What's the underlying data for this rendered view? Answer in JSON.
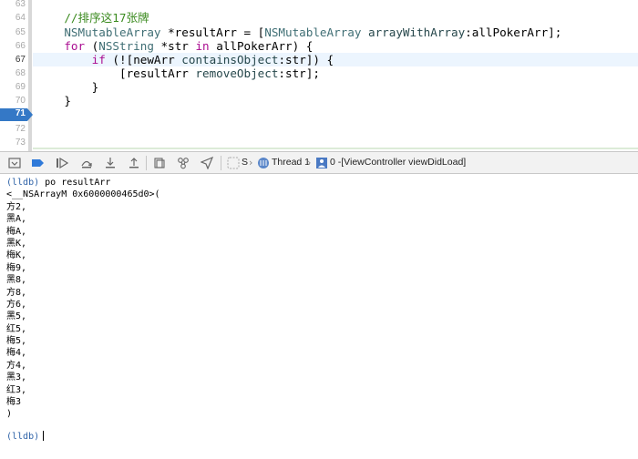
{
  "editor": {
    "lines": [
      {
        "n": "63",
        "code": ""
      },
      {
        "n": "64",
        "code": "    //排序这17张牌"
      },
      {
        "n": "65",
        "code": "    NSMutableArray *resultArr = [NSMutableArray arrayWithArray:allPokerArr];"
      },
      {
        "n": "66",
        "code": "    for (NSString *str in allPokerArr) {"
      },
      {
        "n": "67",
        "code": "        if (![newArr containsObject:str]) {"
      },
      {
        "n": "68",
        "code": "            [resultArr removeObject:str];"
      },
      {
        "n": "69",
        "code": "        }"
      },
      {
        "n": "70",
        "code": "    }"
      },
      {
        "n": "71",
        "code": ""
      },
      {
        "n": "72",
        "code": ""
      },
      {
        "n": "73",
        "code": ""
      }
    ],
    "current_line": "67",
    "breakpoint_line": "71",
    "colors": {
      "keyword": "#aa0d91",
      "type": "#3f6e74",
      "comment": "#3a8a1e",
      "breakpoint": "#3478c6"
    }
  },
  "debug_bar": {
    "icons": [
      "hide-debug-area-icon",
      "breakpoint-toggle-icon",
      "continue-icon",
      "step-over-icon",
      "step-into-icon",
      "step-out-icon",
      "view-hierarchy-icon",
      "memory-graph-icon",
      "location-icon"
    ],
    "crumbs": {
      "app": "S",
      "thread": "Thread 1",
      "frame": "0 -[ViewController viewDidLoad]"
    }
  },
  "console": {
    "prompt": "(lldb)",
    "command": "po resultArr",
    "output": [
      "<__NSArrayM 0x6000000465d0>(",
      "方2,",
      "黑A,",
      "梅A,",
      "黑K,",
      "梅K,",
      "梅9,",
      "黑8,",
      "方8,",
      "方6,",
      "黑5,",
      "红5,",
      "梅5,",
      "梅4,",
      "方4,",
      "黑3,",
      "红3,",
      "梅3",
      ")"
    ]
  }
}
